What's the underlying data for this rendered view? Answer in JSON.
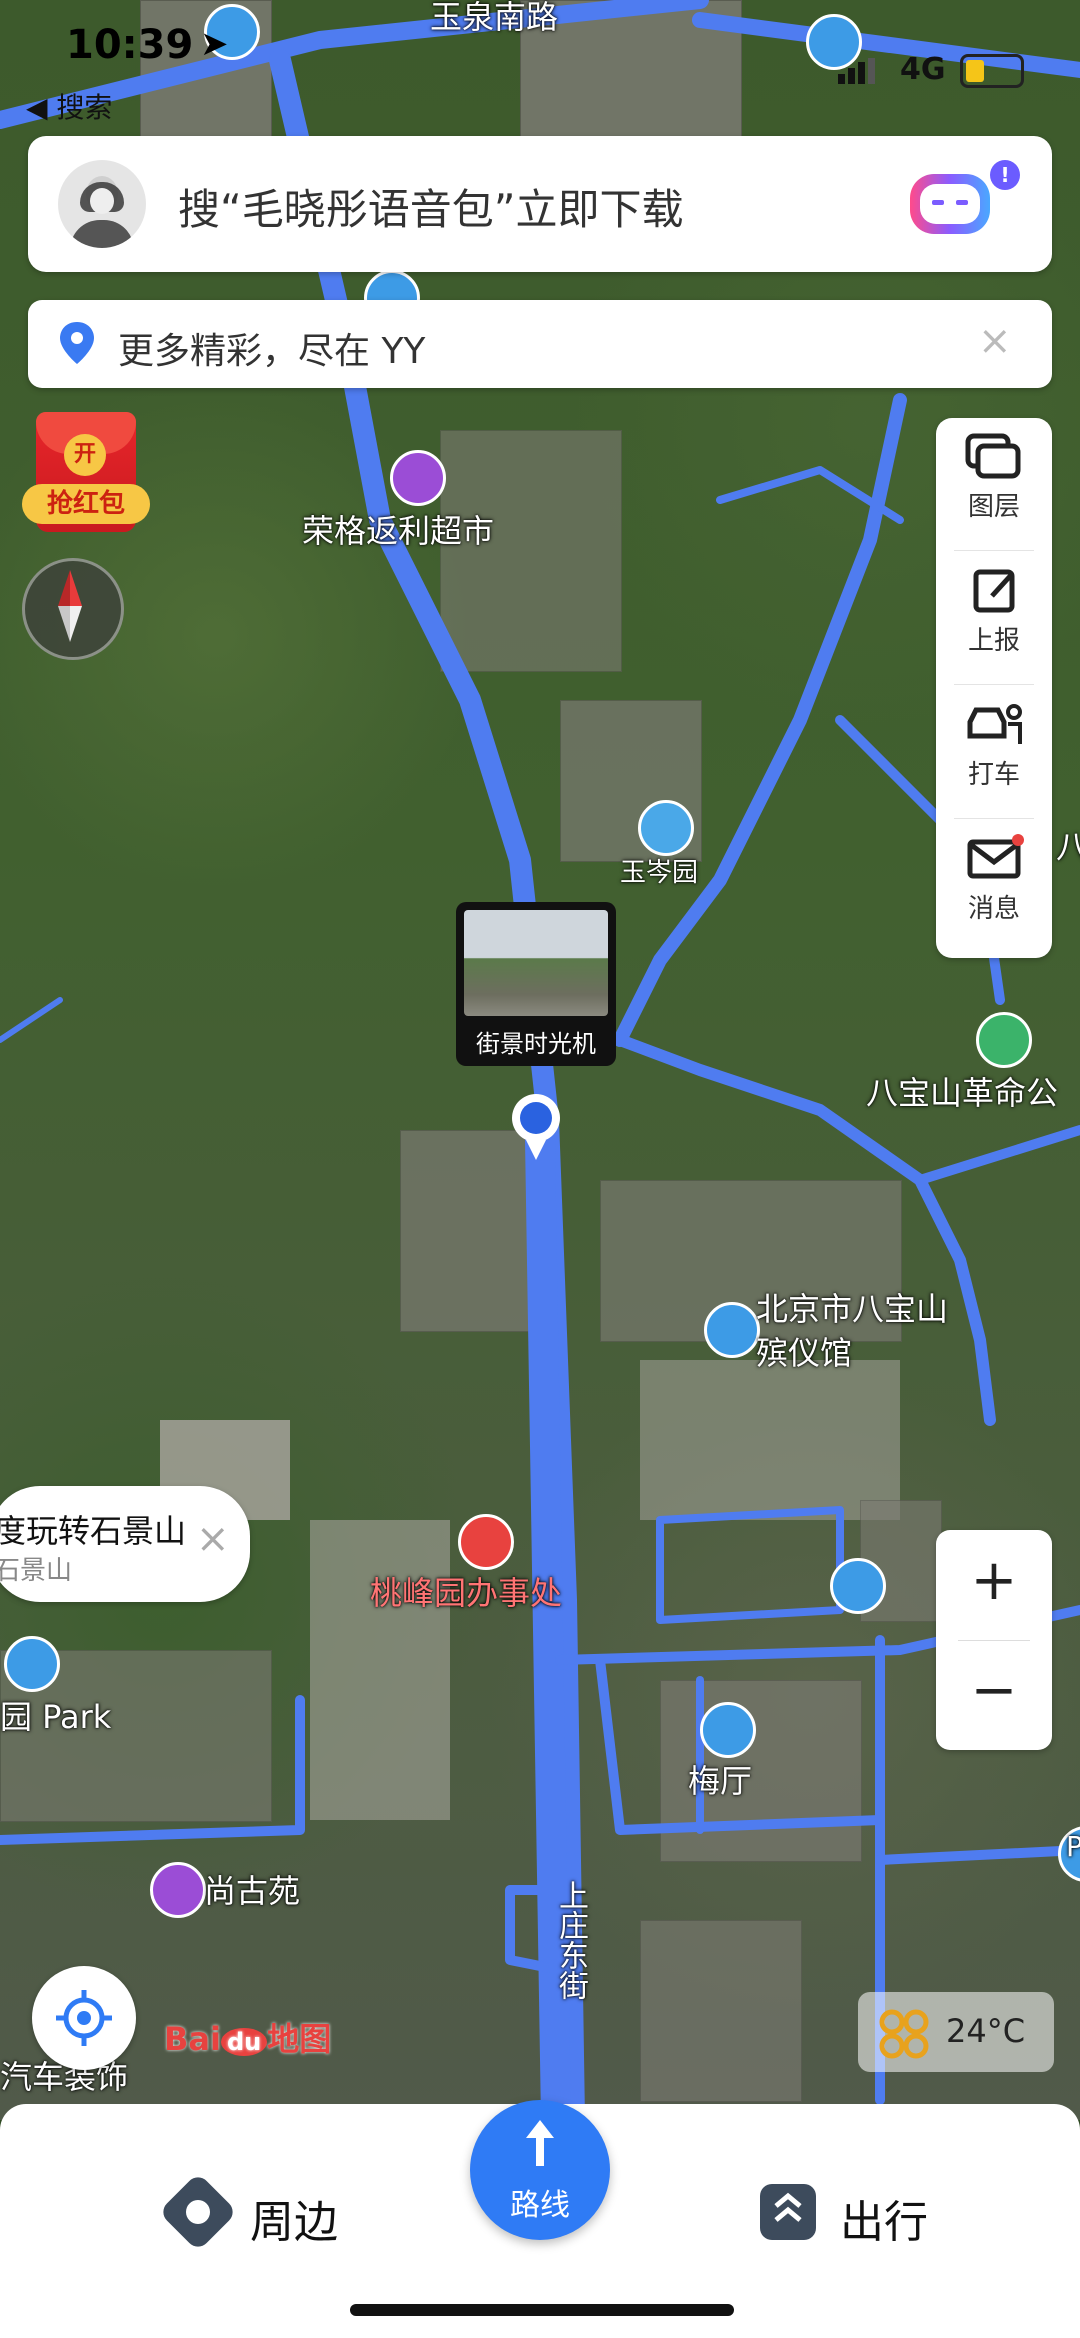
{
  "status_bar": {
    "time": "10:39",
    "back_label": "◀ 搜索",
    "network": "4G"
  },
  "search": {
    "placeholder_text": "搜“毛晓彤语音包”立即下载"
  },
  "promo": {
    "text": "更多精彩，尽在 YY",
    "close_symbol": "×"
  },
  "red_packet": {
    "badge": "开",
    "label": "抢红包"
  },
  "toolbar": {
    "items": [
      {
        "label": "图层"
      },
      {
        "label": "上报"
      },
      {
        "label": "打车"
      },
      {
        "label": "消息"
      }
    ]
  },
  "map_labels": {
    "road_top": "玉泉南路",
    "poi_supermarket": "荣格返利超市",
    "poi_yucen": "玉岑园",
    "poi_babaoshan_revolution": "八宝山革命公",
    "poi_funeral_line1": "北京市八宝山",
    "poi_funeral_line2": "殡仪馆",
    "poi_taofeng": "桃峰园办事处",
    "poi_meiting": "梅厅",
    "poi_shanggu": "尚古苑",
    "road_shangzhuang": "上庄东街",
    "poi_park": "园 Park",
    "poi_auto": "汽车装饰",
    "edge_ba": "八",
    "edge_p": "P",
    "brand_bai": "Bai",
    "brand_du": "du",
    "brand_map": "地图"
  },
  "bubble": {
    "title": "度玩转石景山",
    "subtitle": "石景山",
    "close_symbol": "×"
  },
  "street_view": {
    "label": "街景时光机"
  },
  "zoom": {
    "plus": "+",
    "minus": "−"
  },
  "weather": {
    "temp": "24°C"
  },
  "bottom": {
    "nearby": "周边",
    "route": "路线",
    "travel": "出行"
  },
  "colors": {
    "road": "#4f7cf0",
    "accent": "#2f7bf5",
    "toolbar_bg": "#ffffff"
  }
}
